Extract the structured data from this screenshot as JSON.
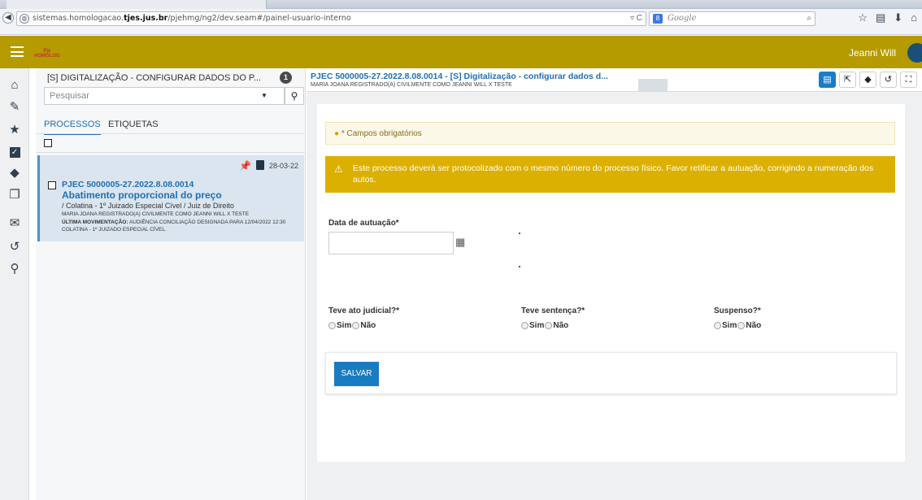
{
  "browser": {
    "url_prefix": "sistemas.homologacao.",
    "url_domain": "tjes.jus.br",
    "url_path": "/pjehmg/ng2/dev.seam#/painel-usuario-interno",
    "url_actions": "▿ C",
    "search_placeholder": "Google",
    "search_engine_badge": "8"
  },
  "app": {
    "logo_line1": "Pje",
    "logo_line2": "HOMOLOG",
    "user_name": "Jeanni Will",
    "header_color": "#b59a00"
  },
  "nav_icons": [
    "home-icon",
    "pencil-icon",
    "star-icon",
    "check-square-icon",
    "tags-icon",
    "copy-icon",
    "envelope-icon",
    "history-icon",
    "search-icon"
  ],
  "list_panel": {
    "title": "[S] DIGITALIZAÇÃO - CONFIGURAR DADOS DO P...",
    "count": "1",
    "search_placeholder": "Pesquisar",
    "tabs": [
      "PROCESSOS",
      "ETIQUETAS"
    ],
    "card": {
      "date": "28-03-22",
      "number": "PJEC 5000005-27.2022.8.08.0014",
      "class": "Abatimento proporcional do preço",
      "org": "/ Colatina - 1º Juizado Especial Cível / Juiz de Direito",
      "parts": "MARIA JOANA REGISTRADO(A) CIVILMENTE COMO JEANNI WILL X TESTE",
      "mov_label": "ÚLTIMA MOVIMENTAÇÃO:",
      "mov_text": "AUDIÊNCIA CONCILIAÇÃO DESIGNADA PARA 12/04/2022 12:30 COLATINA - 1º JUIZADO ESPECIAL CÍVEL."
    }
  },
  "main": {
    "title": "PJEC 5000005-27.2022.8.08.0014 - [S] Digitalização - configurar dados d...",
    "subtitle": "MARIA JOANA REGISTRADO(A) CIVILMENTE COMO JEANNI WILL X TESTE",
    "required_notice": "* Campos obrigatórios",
    "warning": "Este processo deverá ser protocolizado com o mesmo número do processo físico. Favor retificar a autuação, corrigindo a numeração dos autos.",
    "date_label": "Data de autuação*",
    "date_value": "",
    "questions": [
      {
        "label": "Teve ato judicial?*",
        "yes": "Sim",
        "no": "Não"
      },
      {
        "label": "Teve sentença?*",
        "yes": "Sim",
        "no": "Não"
      },
      {
        "label": "Suspenso?*",
        "yes": "Sim",
        "no": "Não"
      }
    ],
    "save_label": "SALVAR"
  }
}
